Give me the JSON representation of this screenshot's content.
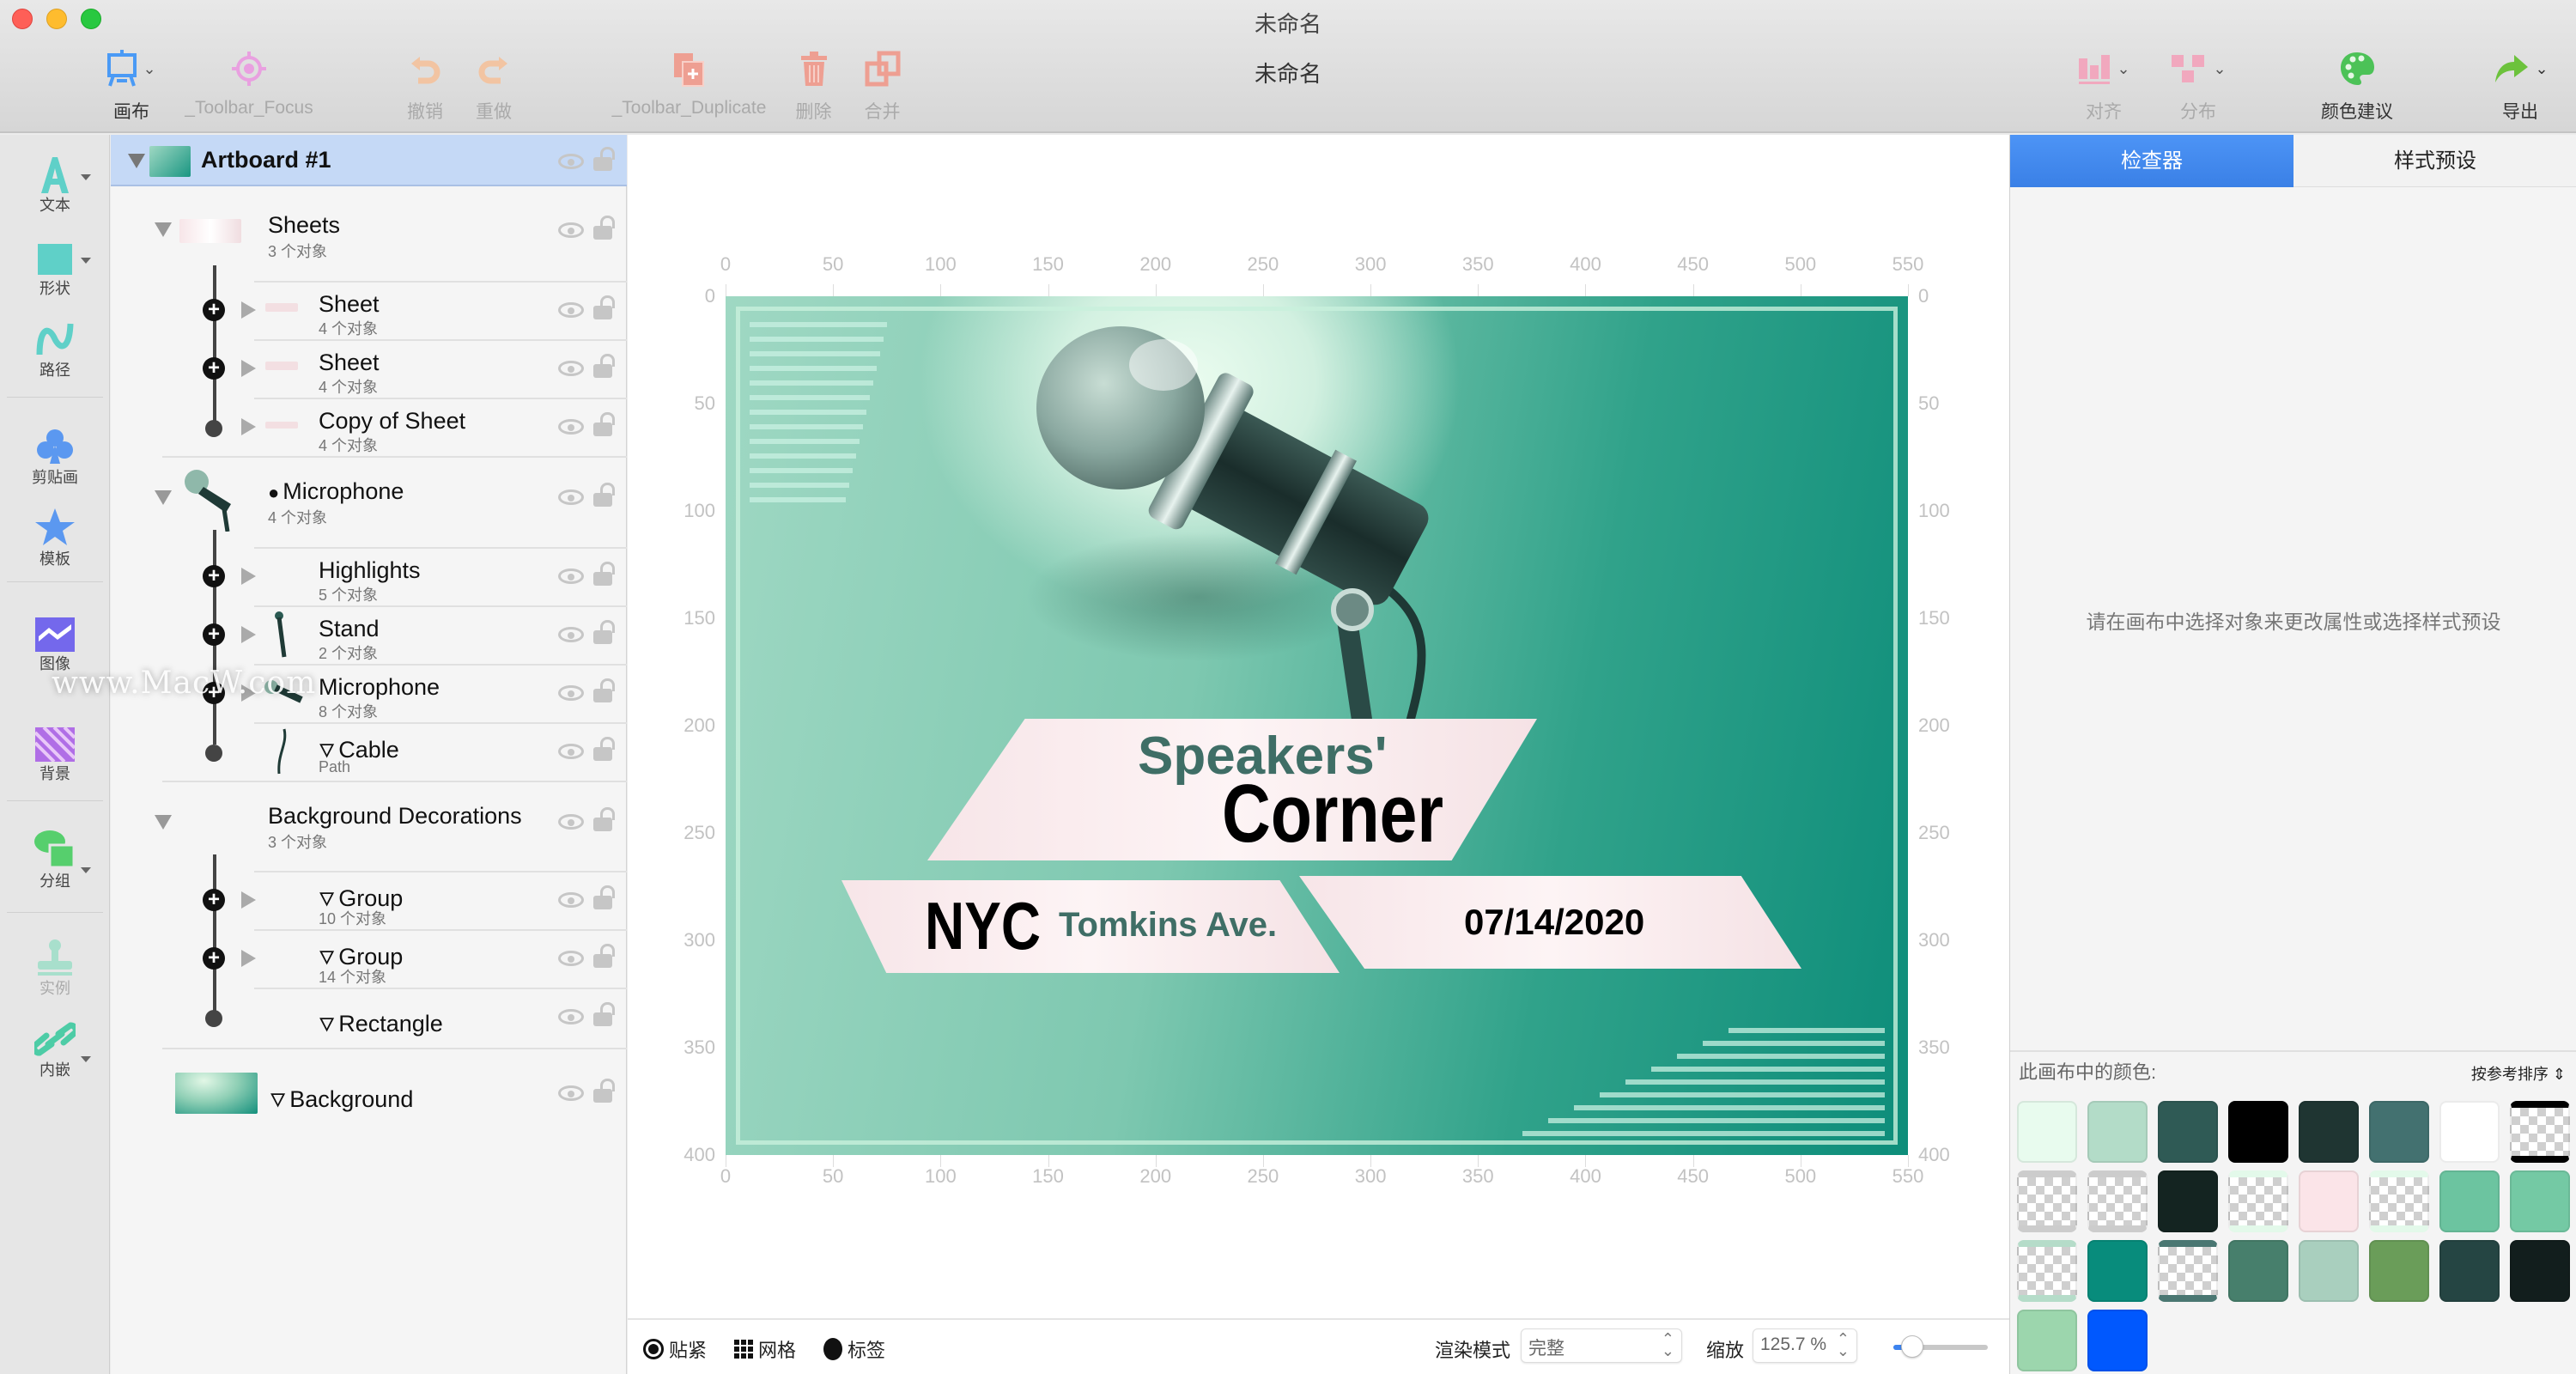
{
  "window": {
    "title": "未命名",
    "document_title": "未命名"
  },
  "toolbar": {
    "left": [
      {
        "id": "canvas",
        "label": "画布",
        "icon": "easel-icon",
        "color": "#4a9af5",
        "dropdown": true
      },
      {
        "id": "focus",
        "label": "_Toolbar_Focus",
        "icon": "target-icon",
        "color": "#e9a0e0",
        "dropdown": false
      },
      {
        "id": "undo",
        "label": "撤销",
        "icon": "undo-icon",
        "color": "#f2c4a2",
        "dropdown": false
      },
      {
        "id": "redo",
        "label": "重做",
        "icon": "redo-icon",
        "color": "#f2c4a2",
        "dropdown": false
      },
      {
        "id": "duplicate",
        "label": "_Toolbar_Duplicate",
        "icon": "duplicate-icon",
        "color": "#ee9f92",
        "dropdown": false
      },
      {
        "id": "delete",
        "label": "删除",
        "icon": "trash-icon",
        "color": "#ee9f92",
        "dropdown": false
      },
      {
        "id": "merge",
        "label": "合并",
        "icon": "merge-icon",
        "color": "#ee9f92",
        "dropdown": false
      }
    ],
    "right": [
      {
        "id": "align",
        "label": "对齐",
        "icon": "align-icon",
        "color": "#f1a8be",
        "dropdown": true
      },
      {
        "id": "distribute",
        "label": "分布",
        "icon": "distribute-icon",
        "color": "#f1a8be",
        "dropdown": true
      },
      {
        "id": "color-suggest",
        "label": "颜色建议",
        "icon": "palette-icon",
        "color": "#4cc257",
        "dropdown": false
      },
      {
        "id": "export",
        "label": "导出",
        "icon": "share-arrow-icon",
        "color": "#6cc23c",
        "dropdown": true
      }
    ]
  },
  "tools": [
    {
      "label": "文本",
      "icon": "text-tool-icon",
      "dropdown": true
    },
    {
      "label": "形状",
      "icon": "shape-tool-icon",
      "dropdown": true
    },
    {
      "label": "路径",
      "icon": "path-tool-icon",
      "dropdown": false
    },
    {
      "label": "剪贴画",
      "icon": "clipart-club-icon",
      "dropdown": false
    },
    {
      "label": "模板",
      "icon": "template-star-icon",
      "dropdown": false
    },
    {
      "label": "图像",
      "icon": "image-tool-icon",
      "dropdown": false
    },
    {
      "label": "背景",
      "icon": "background-tool-icon",
      "dropdown": false
    },
    {
      "label": "分组",
      "icon": "group-tool-icon",
      "dropdown": true
    },
    {
      "label": "实例",
      "icon": "instance-stamp-icon",
      "dropdown": false
    },
    {
      "label": "内嵌",
      "icon": "embed-link-icon",
      "dropdown": true
    }
  ],
  "layers": {
    "artboard": {
      "name": "Artboard #1"
    },
    "items": [
      {
        "name": "Sheets",
        "sub": "3 个对象",
        "level": 0
      },
      {
        "name": "Sheet",
        "sub": "4 个对象",
        "level": 1
      },
      {
        "name": "Sheet",
        "sub": "4 个对象",
        "level": 1
      },
      {
        "name": "Copy of Sheet",
        "sub": "4 个对象",
        "level": 1
      },
      {
        "name": "Microphone",
        "sub": "4 个对象",
        "level": 0
      },
      {
        "name": "Highlights",
        "sub": "5 个对象",
        "level": 1
      },
      {
        "name": "Stand",
        "sub": "2 个对象",
        "level": 1
      },
      {
        "name": "Microphone",
        "sub": "8 个对象",
        "level": 1
      },
      {
        "name": "Cable",
        "sub": "Path",
        "level": 1
      },
      {
        "name": "Background Decorations",
        "sub": "3 个对象",
        "level": 0
      },
      {
        "name": "Group",
        "sub": "10 个对象",
        "level": 1
      },
      {
        "name": "Group",
        "sub": "14 个对象",
        "level": 1
      },
      {
        "name": "Rectangle",
        "sub": "",
        "level": 1
      },
      {
        "name": "Background",
        "sub": "",
        "level": 0
      }
    ]
  },
  "canvas": {
    "ruler_x": [
      "0",
      "50",
      "100",
      "150",
      "200",
      "250",
      "300",
      "350",
      "400",
      "450",
      "500",
      "550"
    ],
    "ruler_y": [
      "0",
      "50",
      "100",
      "150",
      "200",
      "250",
      "300",
      "350",
      "400"
    ],
    "poster": {
      "title_small": "Speakers'",
      "title_big": "Corner",
      "city": "NYC",
      "street": "Tomkins Ave.",
      "date": "07/14/2020"
    }
  },
  "statusbar": {
    "snap": "贴紧",
    "grid": "网格",
    "labels": "标签",
    "render_mode_label": "渲染模式",
    "render_mode_value": "完整",
    "zoom_label": "缩放",
    "zoom_value": "125.7 %",
    "zoom_slider_fraction": 0.2
  },
  "inspector": {
    "tabs": [
      {
        "label": "检查器",
        "active": true
      },
      {
        "label": "样式预设",
        "active": false
      }
    ],
    "empty_message": "请在画布中选择对象来更改属性或选择样式预设",
    "colors_title": "此画布中的颜色:",
    "sort_label": "按参考排序",
    "swatches": [
      {
        "color": "#e8fbee",
        "transparent": false
      },
      {
        "color": "#b3dcc8",
        "transparent": false
      },
      {
        "color": "#2f5a55",
        "transparent": false
      },
      {
        "color": "#000000",
        "transparent": false
      },
      {
        "color": "#1f3532",
        "transparent": false
      },
      {
        "color": "#437170",
        "transparent": false
      },
      {
        "color": "#ffffff",
        "transparent": false
      },
      {
        "color": "#000000",
        "transparent": true
      },
      {
        "color": "#cccccc",
        "transparent": true
      },
      {
        "color": "#cccccc",
        "transparent": true
      },
      {
        "color": "#142421",
        "transparent": false
      },
      {
        "color": "#e3f9ea",
        "transparent": true
      },
      {
        "color": "#fbe4e8",
        "transparent": false
      },
      {
        "color": "#e3f9ea",
        "transparent": true
      },
      {
        "color": "#6cc4a0",
        "transparent": false
      },
      {
        "color": "#74c9a4",
        "transparent": false
      },
      {
        "color": "#b5dcc9",
        "transparent": true
      },
      {
        "color": "#088c7c",
        "transparent": false
      },
      {
        "color": "#4a7772",
        "transparent": true
      },
      {
        "color": "#477f6c",
        "transparent": false
      },
      {
        "color": "#a9cfbe",
        "transparent": false
      },
      {
        "color": "#6a9d59",
        "transparent": false
      },
      {
        "color": "#254543",
        "transparent": false
      },
      {
        "color": "#121e1d",
        "transparent": false
      },
      {
        "color": "#9cd6ad",
        "transparent": false
      },
      {
        "color": "#0058fe",
        "transparent": false
      }
    ]
  },
  "watermark": "www.MacW.com"
}
